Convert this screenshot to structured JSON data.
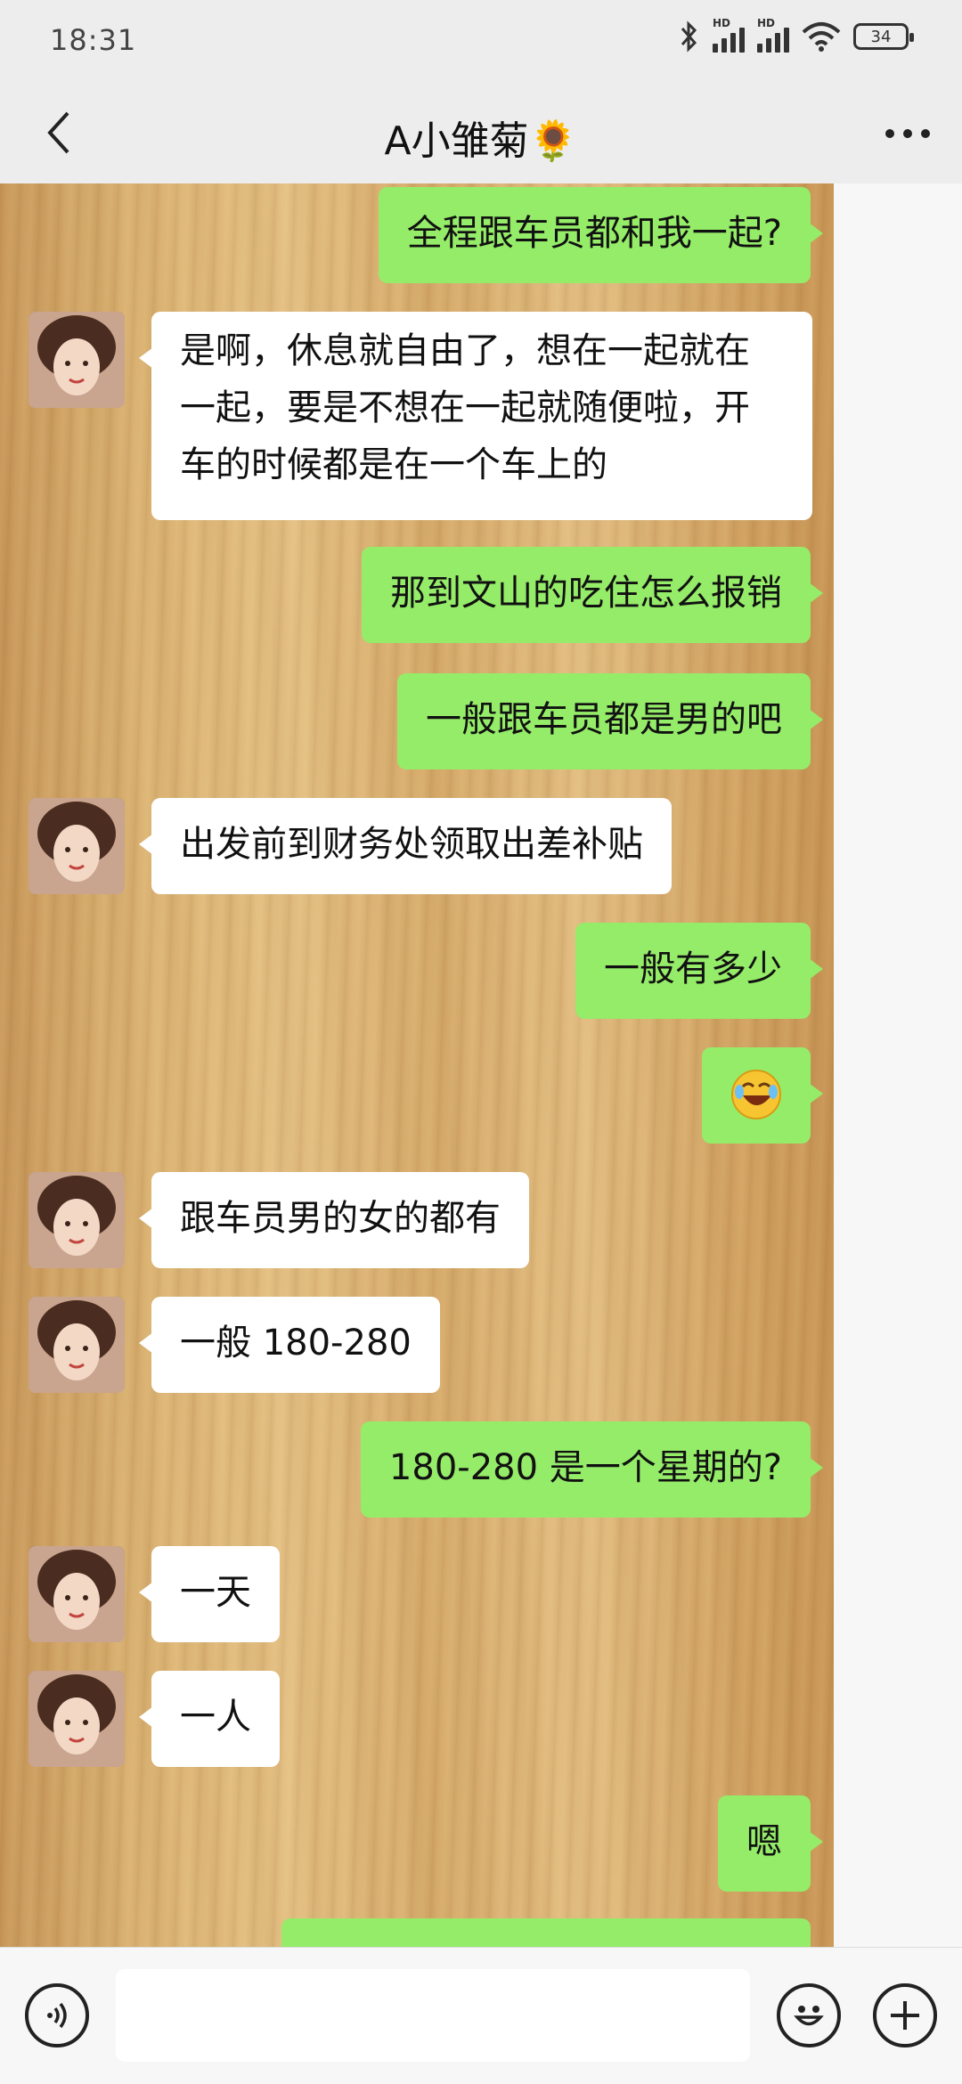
{
  "status_bar": {
    "time": "18:31",
    "battery": "34",
    "signal1_label": "HD",
    "signal2_label": "HD"
  },
  "header": {
    "title": "A小雏菊🌻",
    "back_icon": "chevron-left-icon",
    "more_icon": "more-dots-icon"
  },
  "messages": [
    {
      "side": "right",
      "text": "全程跟车员都和我一起?"
    },
    {
      "side": "left",
      "text": "是啊，休息就自由了，想在一起就在一起，要是不想在一起就随便啦，开车的时候都是在一个车上的"
    },
    {
      "side": "right",
      "text": "那到文山的吃住怎么报销"
    },
    {
      "side": "right",
      "text": "一般跟车员都是男的吧"
    },
    {
      "side": "left",
      "text": "出发前到财务处领取出差补贴"
    },
    {
      "side": "right",
      "text": "一般有多少"
    },
    {
      "side": "right",
      "text": "",
      "emoji": "rolling-on-floor-laughing-emoji"
    },
    {
      "side": "left",
      "text": "跟车员男的女的都有"
    },
    {
      "side": "left",
      "text": "一般 180-280"
    },
    {
      "side": "right",
      "text": "180-280 是一个星期的?"
    },
    {
      "side": "left",
      "text": "一天"
    },
    {
      "side": "left",
      "text": "一人"
    },
    {
      "side": "right",
      "text": "嗯"
    }
  ],
  "input_bar": {
    "voice_icon": "voice-icon",
    "emoji_icon": "emoji-icon",
    "plus_icon": "plus-icon",
    "placeholder": ""
  },
  "colors": {
    "sent_bubble": "#95ec69",
    "received_bubble": "#ffffff",
    "background": "#ededed"
  }
}
